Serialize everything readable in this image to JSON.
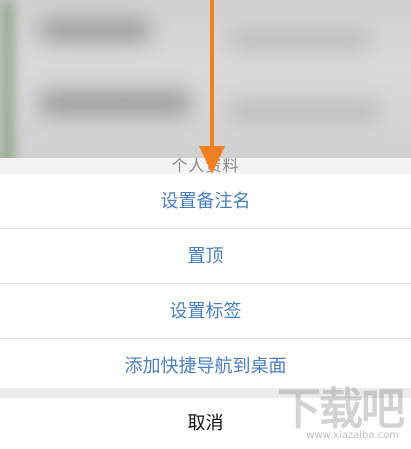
{
  "action_sheet": {
    "title": "个人资料",
    "options": [
      {
        "label": "设置备注名"
      },
      {
        "label": "置顶"
      },
      {
        "label": "设置标签"
      },
      {
        "label": "添加快捷导航到桌面"
      }
    ],
    "cancel_label": "取消"
  },
  "colors": {
    "option_text": "#4a7fc1",
    "cancel_text": "#111111",
    "annotation_arrow": "#f07f22"
  },
  "watermark": {
    "logo": "下载吧",
    "url": "www.xiazaiba.com"
  }
}
